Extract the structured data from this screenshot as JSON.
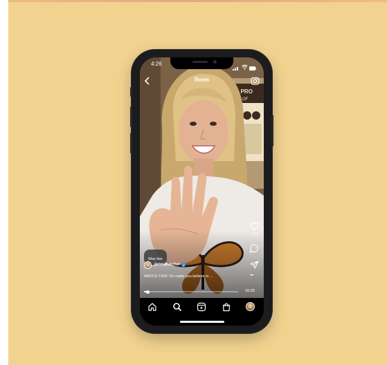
{
  "status_bar": {
    "time": "4:26"
  },
  "header": {
    "title": "Reels"
  },
  "video": {
    "tag": "Was live",
    "username": "jennakutcher",
    "caption": "WATCH THIS: Do really you believe in ...",
    "timestamp": "16:28",
    "progress_fraction": 0.04
  },
  "actions": {
    "like_count": "3,215",
    "more": "•••"
  },
  "icons": {
    "back": "chevron-left-icon",
    "camera": "camera-icon",
    "like": "heart-icon",
    "comment": "comment-icon",
    "share": "send-icon",
    "home": "home-icon",
    "search": "search-icon",
    "reels": "reels-icon",
    "shop": "shop-icon",
    "profile": "avatar"
  },
  "colors": {
    "background": "#f1d28f",
    "phone": "#1c1c1e",
    "verified": "#3797f0"
  }
}
